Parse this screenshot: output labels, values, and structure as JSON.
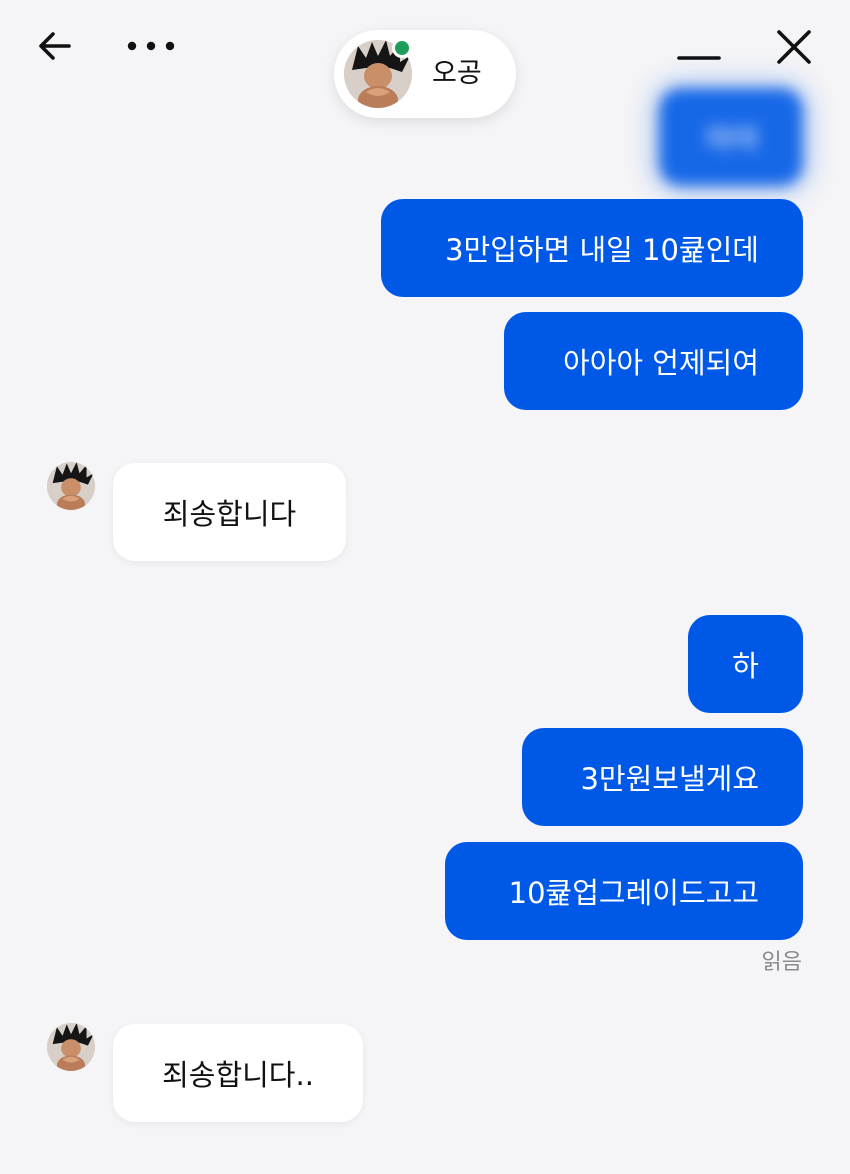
{
  "header": {
    "back_icon": "arrow-left-icon",
    "more_icon": "more-horizontal-icon",
    "minimize_icon": "minimize-icon",
    "close_icon": "close-icon",
    "contact_name": "오공",
    "status": "online",
    "status_color": "#1e9c5a"
  },
  "colors": {
    "my_bubble": "#0059e6",
    "their_bubble": "#ffffff",
    "background": "#f5f5f7"
  },
  "messages": [
    {
      "sender": "me",
      "text": "아아"
    },
    {
      "sender": "me",
      "text": "3만입하면 내일 10큝인데"
    },
    {
      "sender": "me",
      "text": "아아아 언제되여"
    },
    {
      "sender": "them",
      "text": "죄송합니다"
    },
    {
      "sender": "me",
      "text": "하"
    },
    {
      "sender": "me",
      "text": "3만원보낼게요"
    },
    {
      "sender": "me",
      "text": "10큝업그레이드고고"
    },
    {
      "sender": "them",
      "text": "죄송합니다.."
    }
  ],
  "read_receipt": "읽음"
}
